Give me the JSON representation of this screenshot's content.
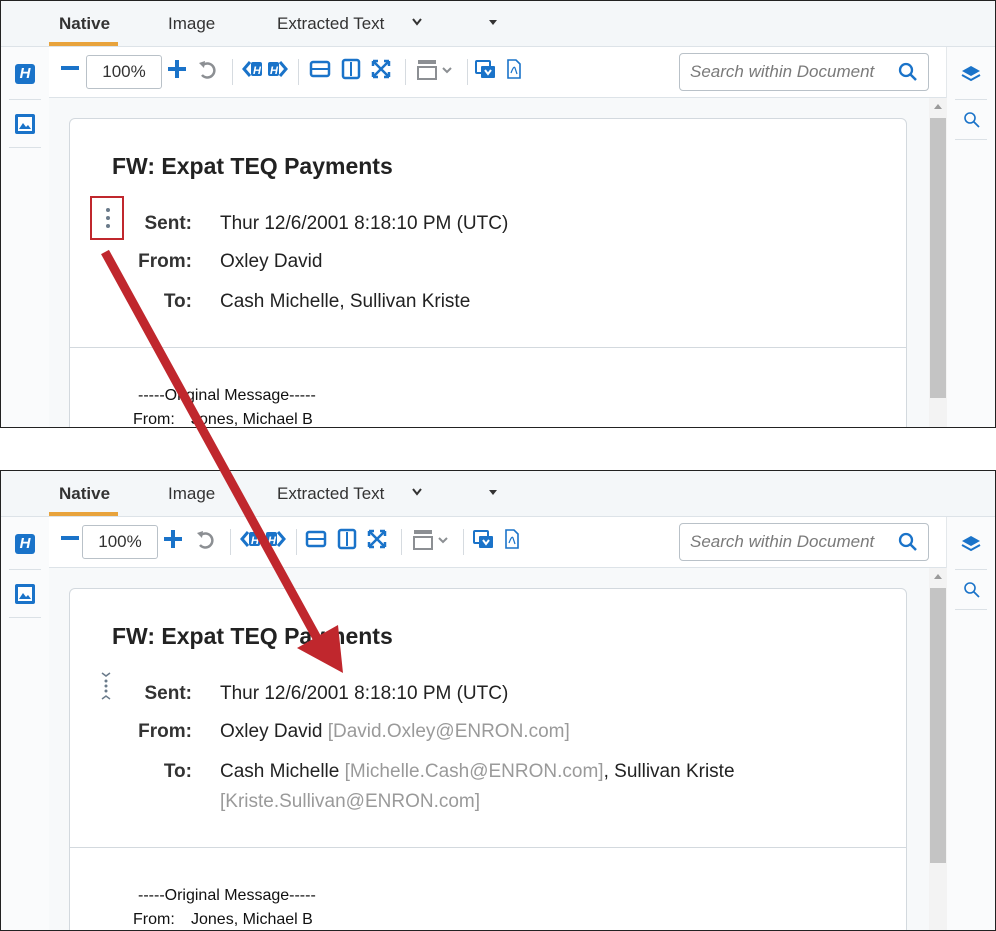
{
  "colors": {
    "accent": "#1a73c9",
    "tab_underline": "#e8a33c",
    "annotation": "#c0272d",
    "email_gray": "#9a9a9a"
  },
  "tabs": [
    {
      "label": "Native",
      "active": true
    },
    {
      "label": "Image",
      "active": false
    },
    {
      "label": "Extracted Text",
      "active": false
    }
  ],
  "toolbar": {
    "zoom_value": "100%",
    "search_placeholder": "Search within Document"
  },
  "icons": {
    "left_rail": [
      "highlight-icon",
      "image-icon"
    ],
    "right_rail": [
      "layers-icon",
      "search-icon"
    ],
    "toolbar": [
      "zoom-out-icon",
      "zoom-in-icon",
      "rotate-icon",
      "prev-hit-icon",
      "next-hit-icon",
      "fit-width-icon",
      "fit-height-icon",
      "fit-page-icon",
      "page-layout-icon",
      "download-icon",
      "pdf-icon"
    ]
  },
  "panel_before": {
    "subject": "FW: Expat TEQ Payments",
    "sent_label": "Sent:",
    "sent_value": "Thur 12/6/2001 8:18:10 PM (UTC)",
    "from_label": "From:",
    "from_value": "Oxley David",
    "to_label": "To:",
    "to_value": "Cash Michelle, Sullivan Kriste",
    "original_message": "-----Original Message-----",
    "orig_from_label": "From:",
    "orig_from_value": "Jones, Michael B"
  },
  "panel_after": {
    "subject": "FW: Expat TEQ Payments",
    "sent_label": "Sent:",
    "sent_value": "Thur 12/6/2001 8:18:10 PM (UTC)",
    "from_label": "From:",
    "from_name": "Oxley David",
    "from_email": "[David.Oxley@ENRON.com]",
    "to_label": "To:",
    "to_name_1": "Cash Michelle",
    "to_email_1": "[Michelle.Cash@ENRON.com]",
    "to_sep": ",",
    "to_name_2": "Sullivan Kriste",
    "to_email_2": "[Kriste.Sullivan@ENRON.com]",
    "original_message": "-----Original Message-----",
    "orig_from_label": "From:",
    "orig_from_value": "Jones, Michael B"
  }
}
